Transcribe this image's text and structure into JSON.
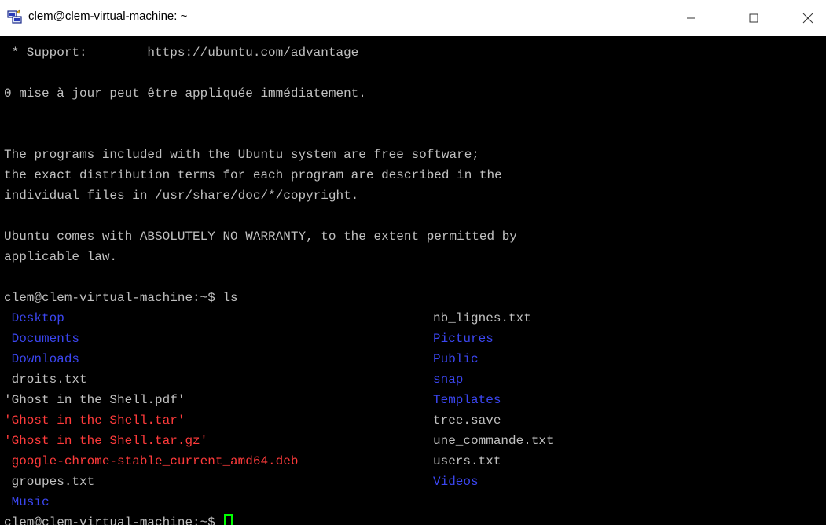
{
  "window": {
    "title": "clem@clem-virtual-machine: ~",
    "controls": {
      "minimize": "—",
      "maximize": "□",
      "close": "✕"
    }
  },
  "colors": {
    "terminal_bg": "#000000",
    "text": "#c0c0c0",
    "directory": "#3b46f0",
    "archive": "#ff3b3b",
    "cursor": "#00ff00"
  },
  "terminal": {
    "motd": [
      " * Support:        https://ubuntu.com/advantage",
      "",
      "0 mise à jour peut être appliquée immédiatement.",
      "",
      "",
      "The programs included with the Ubuntu system are free software;",
      "the exact distribution terms for each program are described in the",
      "individual files in /usr/share/doc/*/copyright.",
      "",
      "Ubuntu comes with ABSOLUTELY NO WARRANTY, to the extent permitted by",
      "applicable law.",
      ""
    ],
    "command_line": "clem@clem-virtual-machine:~$ ls",
    "ls_left": [
      {
        "name": " Desktop",
        "type": "dir"
      },
      {
        "name": " Documents",
        "type": "dir"
      },
      {
        "name": " Downloads",
        "type": "dir"
      },
      {
        "name": " droits.txt",
        "type": "file"
      },
      {
        "name": "'Ghost in the Shell.pdf'",
        "type": "file"
      },
      {
        "name": "'Ghost in the Shell.tar'",
        "type": "archive"
      },
      {
        "name": "'Ghost in the Shell.tar.gz'",
        "type": "archive"
      },
      {
        "name": " google-chrome-stable_current_amd64.deb",
        "type": "archive"
      },
      {
        "name": " groupes.txt",
        "type": "file"
      },
      {
        "name": " Music",
        "type": "dir"
      }
    ],
    "ls_right": [
      {
        "name": "nb_lignes.txt",
        "type": "file"
      },
      {
        "name": "Pictures",
        "type": "dir"
      },
      {
        "name": "Public",
        "type": "dir"
      },
      {
        "name": "snap",
        "type": "dir"
      },
      {
        "name": "Templates",
        "type": "dir"
      },
      {
        "name": "tree.save",
        "type": "file"
      },
      {
        "name": "une_commande.txt",
        "type": "file"
      },
      {
        "name": "users.txt",
        "type": "file"
      },
      {
        "name": "Videos",
        "type": "dir"
      }
    ],
    "prompt": "clem@clem-virtual-machine:~$ "
  },
  "icons": {
    "app": "putty-icon",
    "cursor": "terminal-cursor"
  }
}
